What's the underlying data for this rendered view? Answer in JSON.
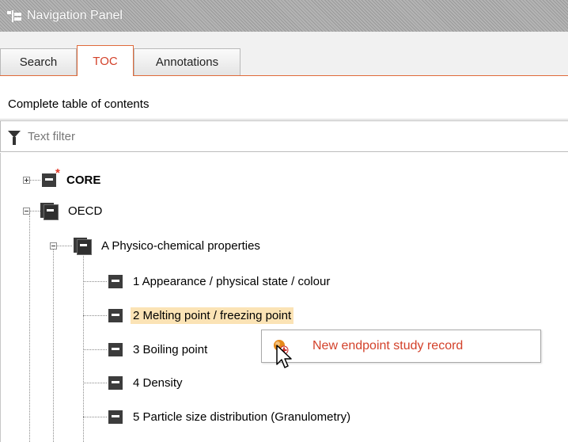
{
  "panel": {
    "title": "Navigation Panel"
  },
  "tabs": [
    {
      "label": "Search",
      "active": false
    },
    {
      "label": "TOC",
      "active": true
    },
    {
      "label": "Annotations",
      "active": false
    }
  ],
  "subheader": "Complete table of contents",
  "filter": {
    "placeholder": "Text filter",
    "value": ""
  },
  "tree": {
    "core": {
      "label": "CORE"
    },
    "oecd": {
      "label": "OECD"
    },
    "section": {
      "label": "A Physico-chemical properties"
    },
    "items": [
      {
        "label": "1 Appearance / physical state / colour"
      },
      {
        "label": "2 Melting point / freezing point",
        "selected": true
      },
      {
        "label": "3 Boiling point"
      },
      {
        "label": "4 Density"
      },
      {
        "label": "5 Particle size distribution (Granulometry)"
      }
    ]
  },
  "context_menu": {
    "item_label": "New endpoint study record"
  },
  "colors": {
    "accent": "#d3412a",
    "selection": "#fbe3b5",
    "tab_border": "#e06a3a"
  },
  "icons": [
    "navigation-panel-icon",
    "filter-funnel-icon",
    "document-icon",
    "folder-icon",
    "add-record-icon",
    "mouse-cursor-icon"
  ]
}
